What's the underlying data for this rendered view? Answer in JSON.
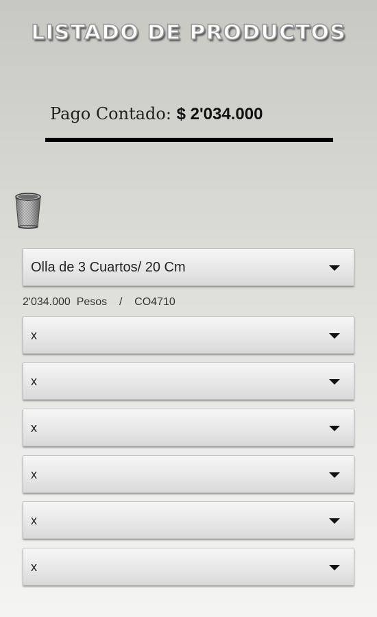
{
  "header": {
    "title": "LISTADO DE PRODUCTOS"
  },
  "payment": {
    "label": "Pago Contado: ",
    "currency_symbol": "$",
    "amount": "2'034.000"
  },
  "icons": {
    "trash": "trash-can-icon",
    "dropdown_arrow": "caret-down-icon"
  },
  "product_select": {
    "selected": "Olla de 3 Cuartos/ 20 Cm"
  },
  "product_detail": {
    "price": "2'034.000",
    "unit": "Pesos",
    "separator": "/",
    "code": "CO4710"
  },
  "extra_selects": [
    {
      "selected": "x"
    },
    {
      "selected": "x"
    },
    {
      "selected": "x"
    },
    {
      "selected": "x"
    },
    {
      "selected": "x"
    },
    {
      "selected": "x"
    }
  ],
  "colors": {
    "divider": "#000000",
    "select_background": "#e6e6e6",
    "background_top": "#c8c8c2",
    "background_bottom": "#f4f4f2"
  }
}
